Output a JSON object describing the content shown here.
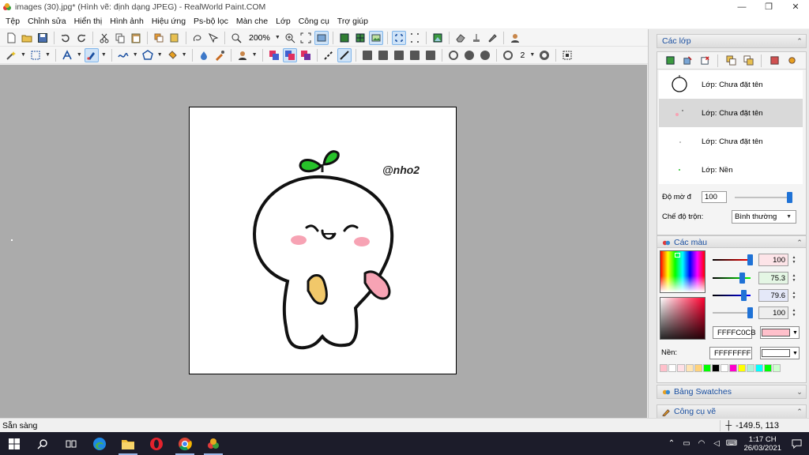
{
  "window": {
    "title": "images (30).jpg* (Hình vẽ: định dạng JPEG) - RealWorld Paint.COM",
    "minimize": "—",
    "maximize": "❐",
    "close": "✕"
  },
  "menu": [
    "Tệp",
    "Chỉnh sửa",
    "Hiển thị",
    "Hình ảnh",
    "Hiệu ứng",
    "Ps-bộ lọc",
    "Màn che",
    "Lớp",
    "Công cụ",
    "Trợ giúp"
  ],
  "toolbar": {
    "zoom": "200%",
    "brush_size": "2"
  },
  "canvas_image": {
    "watermark": "@nho2"
  },
  "status": {
    "text": "Sẵn sàng",
    "coords": "-149.5, 113"
  },
  "layers_panel": {
    "title": "Các lớp",
    "layers": [
      {
        "name": "Lớp: Chưa đặt tên"
      },
      {
        "name": "Lớp: Chưa đặt tên"
      },
      {
        "name": "Lớp: Chưa đặt tên"
      },
      {
        "name": "Lớp: Nền"
      }
    ],
    "opacity_label": "Độ mờ đ",
    "opacity_value": "100",
    "blend_label": "Chế độ trộn:",
    "blend_value": "Bình thường"
  },
  "colors_panel": {
    "title": "Các màu",
    "channels": [
      "100",
      "75.3",
      "79.6",
      "100"
    ],
    "primary_hex": "FFFFC0CB",
    "primary_color": "#ffc0cb",
    "bg_label": "Nền:",
    "bg_hex": "FFFFFFFF",
    "bg_color": "#ffffff",
    "palette": [
      "#ffc0cb",
      "#ffffff",
      "#ffe0e6",
      "#ffe5b4",
      "#ffd27a",
      "#00ff00",
      "#000000",
      "#ffffff",
      "#ff00cc",
      "#ffff00",
      "#aef0d8",
      "#00ffff",
      "#00ff00",
      "#d0ffd0"
    ]
  },
  "swatches_panel": {
    "title": "Bảng Swatches"
  },
  "tools_panel": {
    "title": "Công cụ vẽ"
  },
  "taskbar": {
    "time": "1:17 CH",
    "date": "26/03/2021"
  }
}
